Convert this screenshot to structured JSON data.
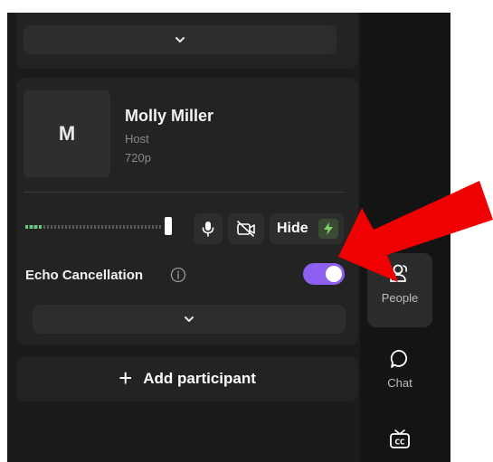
{
  "participant": {
    "initial": "M",
    "name": "Molly Miller",
    "role": "Host",
    "resolution": "720p",
    "audio_level": 0.12
  },
  "controls": {
    "hide_label": "Hide"
  },
  "echo": {
    "label": "Echo Cancellation",
    "enabled": true
  },
  "add_participant": {
    "plus": "+",
    "label": "Add participant"
  },
  "rail": {
    "people_label": "People",
    "chat_label": "Chat"
  },
  "colors": {
    "toggle_on": "#8e5ff0",
    "annotation_arrow": "#f00000",
    "bolt": "#7fd16a"
  },
  "icons": {
    "expand": "chevron-down-icon",
    "mic": "microphone-icon",
    "camera_off": "camera-off-icon",
    "bolt": "lightning-bolt-icon",
    "info": "info-icon",
    "people": "people-icon",
    "chat": "chat-bubble-icon",
    "captions": "closed-captions-icon"
  }
}
